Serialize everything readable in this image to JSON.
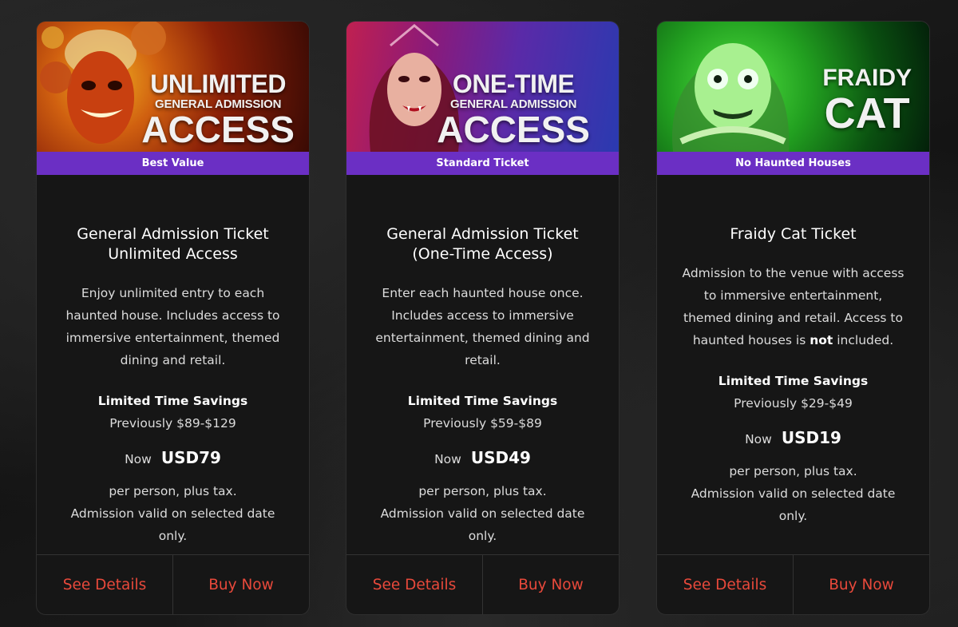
{
  "cards": [
    {
      "hero": {
        "line1": "UNLIMITED",
        "line2": "GENERAL ADMISSION",
        "line3": "ACCESS"
      },
      "badge": "Best Value",
      "title_line1": "General Admission Ticket",
      "title_line2": "Unlimited Access",
      "desc_lines": [
        "Enjoy unlimited entry to each",
        "haunted house. Includes access to",
        "immersive entertainment, themed",
        "dining and retail."
      ],
      "savings": "Limited Time Savings",
      "previous": "Previously $89-$129",
      "now_label": "Now",
      "now_price": "USD79",
      "fine_lines": [
        "per person, plus tax.",
        "Admission valid on selected date",
        "only."
      ],
      "details_label": "See Details",
      "buy_label": "Buy Now"
    },
    {
      "hero": {
        "line1": "ONE-TIME",
        "line2": "GENERAL ADMISSION",
        "line3": "ACCESS"
      },
      "badge": "Standard Ticket",
      "title_line1": "General Admission Ticket",
      "title_line2": "(One-Time Access)",
      "desc_lines": [
        "Enter each haunted house once.",
        "Includes access to immersive",
        "entertainment, themed dining and",
        "retail."
      ],
      "savings": "Limited Time Savings",
      "previous": "Previously $59-$89",
      "now_label": "Now",
      "now_price": "USD49",
      "fine_lines": [
        "per person, plus tax.",
        "Admission valid on selected date",
        "only."
      ],
      "details_label": "See Details",
      "buy_label": "Buy Now"
    },
    {
      "hero": {
        "line1": "FRAIDY",
        "line2": "CAT"
      },
      "badge": "No Haunted Houses",
      "title_line1": "Fraidy Cat Ticket",
      "desc_lines": [
        "Admission to the venue with access",
        "to immersive entertainment,",
        "themed dining and retail. Access to"
      ],
      "desc_last_pre": "haunted houses is ",
      "desc_last_bold": "not",
      "desc_last_post": " included.",
      "savings": "Limited Time Savings",
      "previous": "Previously $29-$49",
      "now_label": "Now",
      "now_price": "USD19",
      "fine_lines": [
        "per person, plus tax.",
        "Admission valid on selected date",
        "only."
      ],
      "details_label": "See Details",
      "buy_label": "Buy Now"
    }
  ],
  "colors": {
    "badge": "#6b2fc4",
    "action": "#e8493b",
    "card": "#161616"
  }
}
